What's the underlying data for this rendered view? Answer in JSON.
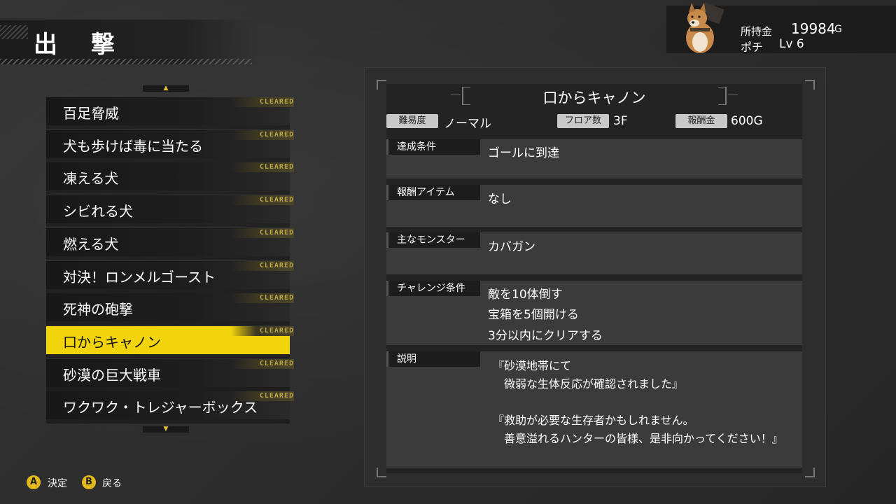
{
  "header": {
    "title": "出 撃"
  },
  "player": {
    "money_label": "所持金",
    "money_value": "19984",
    "money_unit": "G",
    "name": "ポチ",
    "level": "Lv 6",
    "avatar_icon": "shiba-dog-avatar-icon"
  },
  "mission_list": {
    "scroll_up_icon": "chevron-up-icon",
    "scroll_down_icon": "chevron-down-icon",
    "selected_index": 7,
    "cleared_badge": "CLEARED",
    "items": [
      {
        "label": "百足脅威",
        "cleared": true
      },
      {
        "label": "犬も歩けば毒に当たる",
        "cleared": true
      },
      {
        "label": "凍える犬",
        "cleared": true
      },
      {
        "label": "シビれる犬",
        "cleared": true
      },
      {
        "label": "燃える犬",
        "cleared": true
      },
      {
        "label": "対決！ロンメルゴースト",
        "cleared": true
      },
      {
        "label": "死神の砲撃",
        "cleared": true
      },
      {
        "label": "口からキャノン",
        "cleared": true
      },
      {
        "label": "砂漠の巨大戦車",
        "cleared": true
      },
      {
        "label": "ワクワク・トレジャーボックス",
        "cleared": true
      }
    ]
  },
  "detail": {
    "title": "口からキャノン",
    "difficulty_label": "難易度",
    "difficulty_value": "ノーマル",
    "floors_label": "フロア数",
    "floors_value": "3F",
    "reward_money_label": "報酬金",
    "reward_money_value": "600G",
    "sections": {
      "goal": {
        "label": "達成条件",
        "text": "ゴールに到達"
      },
      "reward_item": {
        "label": "報酬アイテム",
        "text": "なし"
      },
      "monsters": {
        "label": "主なモンスター",
        "text": "カバガン"
      },
      "challenge": {
        "label": "チャレンジ条件",
        "lines": [
          "敵を10体倒す",
          "宝箱を5個開ける",
          "3分以内にクリアする"
        ]
      },
      "description": {
        "label": "説明",
        "text": "『砂漠地帯にて\n　微弱な生体反応が確認されました』\n\n『救助が必要な生存者かもしれません。\n　善意溢れるハンターの皆様、是非向かってください！』"
      }
    }
  },
  "footer": {
    "confirm_button": "A",
    "confirm_label": "決定",
    "back_button": "B",
    "back_label": "戻る"
  },
  "colors": {
    "accent": "#f2d40c",
    "button": "#e3b81a",
    "cleared_text": "#b8a443"
  }
}
